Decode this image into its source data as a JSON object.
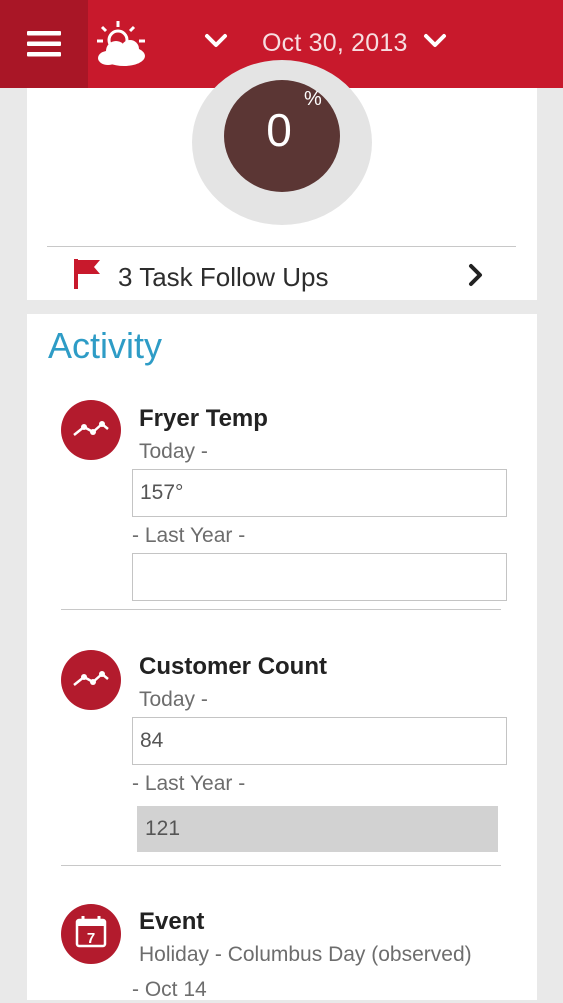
{
  "header": {
    "date": "Oct 30, 2013",
    "menu_icon": "hamburger-menu-icon",
    "weather_icon": "partly-cloudy-icon",
    "colors": {
      "bar": "#c8192c",
      "menu_bg": "#a91626"
    }
  },
  "progress": {
    "value": "0",
    "unit": "%"
  },
  "tasks": {
    "label": "3 Task Follow Ups"
  },
  "activity": {
    "title": "Activity",
    "title_color": "#2e9cc6",
    "items": [
      {
        "title": "Fryer Temp",
        "today_label": "Today -",
        "today_value": "157°",
        "last_year_label": "- Last Year -",
        "last_year_value": ""
      },
      {
        "title": "Customer Count",
        "today_label": "Today -",
        "today_value": "84",
        "last_year_label": "- Last Year -",
        "last_year_value": "121"
      },
      {
        "title": "Event",
        "detail": "Holiday - Columbus Day (observed)",
        "date": "- Oct 14",
        "calendar_day": "7"
      }
    ]
  }
}
